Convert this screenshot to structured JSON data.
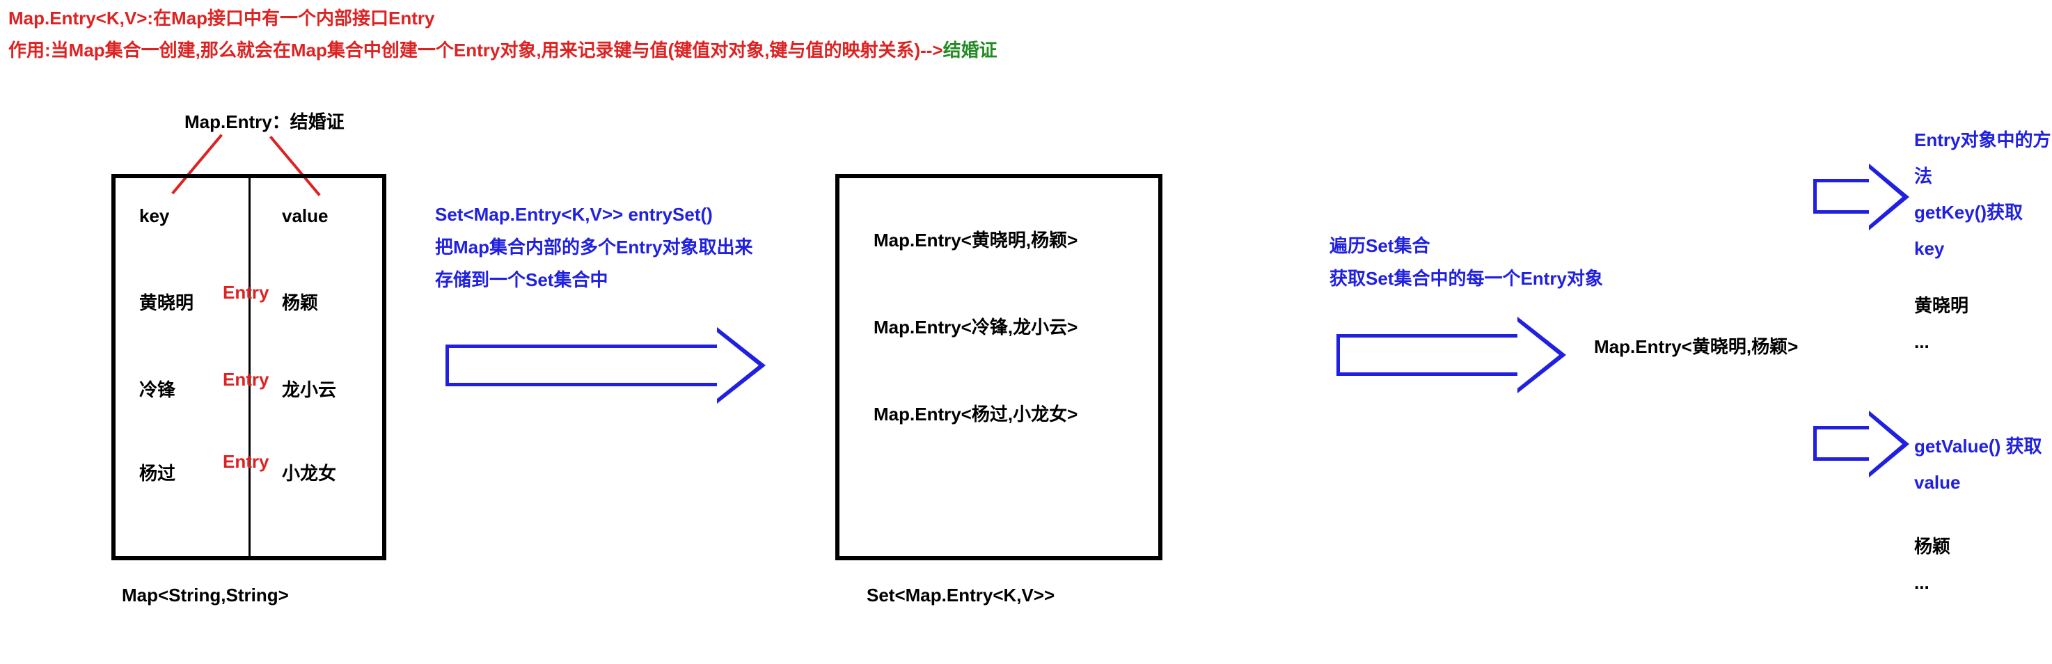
{
  "header": {
    "line1": "Map.Entry<K,V>:在Map接口中有一个内部接口Entry",
    "line2_red": "作用:当Map集合一创建,那么就会在Map集合中创建一个Entry对象,用来记录键与值(键值对对象,键与值的映射关系)-->",
    "line2_green": "结婚证"
  },
  "map": {
    "title": "Map.Entry：结婚证",
    "header_key": "key",
    "header_value": "value",
    "entry_word": "Entry",
    "rows": [
      {
        "key": "黄晓明",
        "value": "杨颖"
      },
      {
        "key": "冷锋",
        "value": "龙小云"
      },
      {
        "key": "杨过",
        "value": "小龙女"
      }
    ],
    "type_label": "Map<String,String>"
  },
  "entrySet_note": {
    "line1": "Set<Map.Entry<K,V>> entrySet()",
    "line2": " 把Map集合内部的多个Entry对象取出来",
    "line3": "存储到一个Set集合中"
  },
  "set": {
    "items": [
      "Map.Entry<黄晓明,杨颖>",
      "Map.Entry<冷锋,龙小云>",
      "Map.Entry<杨过,小龙女>"
    ],
    "type_label": "Set<Map.Entry<K,V>>"
  },
  "traverse_note": {
    "line1": "遍历Set集合",
    "line2": "获取Set集合中的每一个Entry对象"
  },
  "entry_object": "Map.Entry<黄晓明,杨颖>",
  "getKey": {
    "title": "Entry对象中的方法",
    "method": "getKey()获取key",
    "result": "黄晓明",
    "ellipsis": "..."
  },
  "getValue": {
    "method": "getValue()  获取value",
    "result": "杨颖",
    "ellipsis": "..."
  }
}
